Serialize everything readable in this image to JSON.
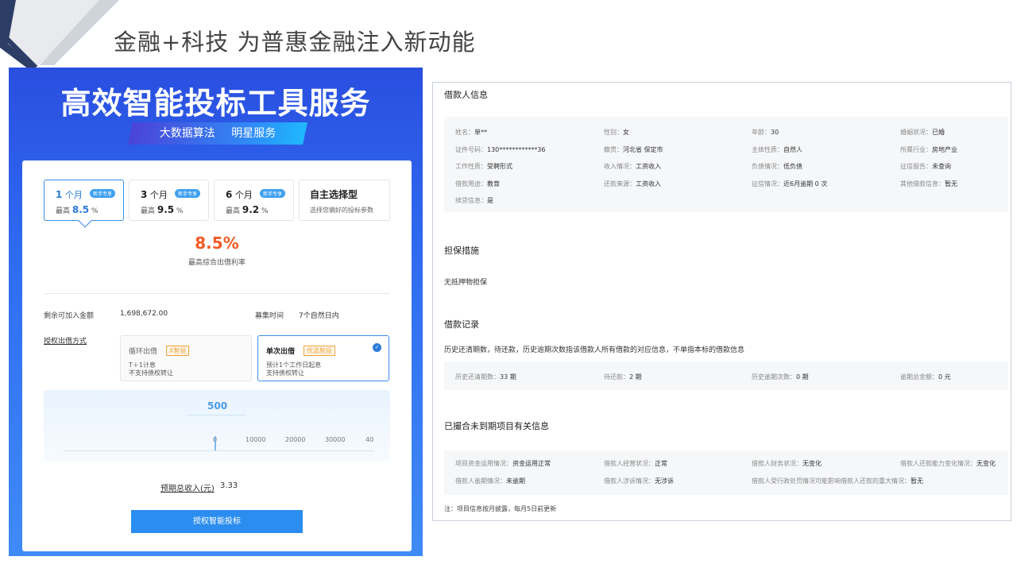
{
  "slide": {
    "title": "金融+科技 为普惠金融注入新动能"
  },
  "left": {
    "headline": "高效智能投标工具服务",
    "tags": [
      "大数据算法",
      "明星服务"
    ],
    "options": [
      {
        "months": "1",
        "unit": "个月",
        "badge": "新手专享",
        "rate_prefix": "最高",
        "rate": "8.5",
        "rate_unit": "%"
      },
      {
        "months": "3",
        "unit": "个月",
        "badge": "新手专享",
        "rate_prefix": "最高",
        "rate": "9.5",
        "rate_unit": "%"
      },
      {
        "months": "6",
        "unit": "个月",
        "badge": "新手专享",
        "rate_prefix": "最高",
        "rate": "9.2",
        "rate_unit": "%"
      }
    ],
    "custom_option": {
      "title": "自主选择型",
      "subtitle": "选择您偏好的投标参数"
    },
    "rate_value": "8.5%",
    "rate_label": "最高综合出借利率",
    "remaining_label": "剩余可加入金额",
    "remaining_value": "1,698,672.00",
    "raise_label": "募集时间",
    "raise_value": "7个自然日内",
    "method_label": "授权出借方式",
    "methods": [
      {
        "title": "循环出借",
        "tag": "X智投",
        "desc1": "T＋1计息",
        "desc2": "不支持债权转让"
      },
      {
        "title": "单次出借",
        "tag": "优选智投",
        "desc1": "预计1个工作日起息",
        "desc2": "支持债权转让"
      }
    ],
    "slider": {
      "amount": "500",
      "ticks": [
        "0",
        "10000",
        "20000",
        "30000",
        "40"
      ]
    },
    "income_label": "预期总收入(元)",
    "income_value": "3.33",
    "submit_label": "授权智能投标"
  },
  "right": {
    "borrower": {
      "title": "借款人信息",
      "rows": [
        [
          [
            "姓名：",
            "单**"
          ],
          [
            "性别：",
            "女"
          ],
          [
            "年龄：",
            "30"
          ],
          [
            "婚姻状况：",
            "已婚"
          ]
        ],
        [
          [
            "证件号码：",
            "130************36"
          ],
          [
            "籍贯：",
            "河北省 保定市"
          ],
          [
            "主体性质：",
            "自然人"
          ],
          [
            "所属行业：",
            "房地产业"
          ]
        ],
        [
          [
            "工作性质：",
            "受聘形式"
          ],
          [
            "收入情况：",
            "工资收入"
          ],
          [
            "负债情况：",
            "低负债"
          ],
          [
            "征信报告：",
            "未查询"
          ]
        ],
        [
          [
            "借款用途：",
            "教育"
          ],
          [
            "还款来源：",
            "工资收入"
          ],
          [
            "征信情况：",
            "近6月逾期 0 次"
          ],
          [
            "其他借款信息：",
            "暂无"
          ]
        ],
        [
          [
            "续贷信息：",
            "是"
          ]
        ]
      ]
    },
    "guarantee": {
      "title": "担保措施",
      "text": "无抵押物担保"
    },
    "records": {
      "title": "借款记录",
      "note": "历史还清期数，待还款，历史逾期次数指该借款人所有借款的对应信息，不单指本标的借款信息",
      "cells": [
        [
          "历史还清期数：",
          "33 期"
        ],
        [
          "待还款：",
          "2 期"
        ],
        [
          "历史逾期次数：",
          "0 期"
        ],
        [
          "逾期总金额：",
          "0 元"
        ]
      ]
    },
    "matched": {
      "title": "已撮合未到期项目有关信息",
      "rows": [
        [
          [
            "项目资金运用情况：",
            "资金运用正常"
          ],
          [
            "借款人经营状况：",
            "正常"
          ],
          [
            "借款人财务状况：",
            "无变化"
          ],
          [
            "借款人还款能力变化情况：",
            "无变化"
          ]
        ],
        [
          [
            "借款人逾期情况：",
            "未逾期"
          ],
          [
            "借款人涉诉情况：",
            "无涉诉"
          ],
          [
            "借款人受行政处罚情况可能影响借款人还款的重大情况：",
            "暂无"
          ]
        ]
      ]
    },
    "footnote": "注：项目信息按月披露，每月5日前更新"
  }
}
